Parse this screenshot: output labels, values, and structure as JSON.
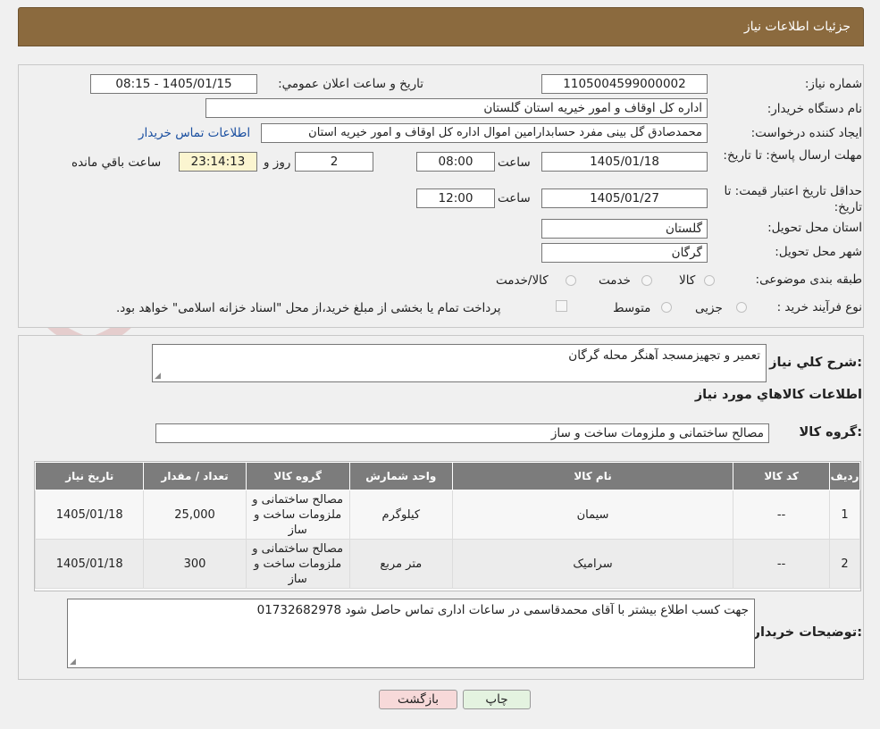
{
  "header": {
    "title": "جزئیات اطلاعات نیاز"
  },
  "form": {
    "need_number_label": "شماره نیاز:",
    "need_number": "1105004599000002",
    "announce_label": "تاریخ و ساعت اعلان عمومي:",
    "announce_value": "1405/01/15 - 08:15",
    "buyer_label": "نام دستگاه خریدار:",
    "buyer_value": "اداره کل اوقاف و امور خیریه استان گلستان",
    "creator_label": "ایجاد کننده درخواست:",
    "creator_value": "محمدصادق گل بینی مفرد حسابدارامین اموال اداره کل اوقاف و امور خیریه استان",
    "contact_link": "اطلاعات تماس خریدار",
    "deadline_label": "مهلت ارسال پاسخ: تا تاریخ:",
    "deadline_date": "1405/01/18",
    "time_label": "ساعت",
    "deadline_time": "08:00",
    "days_value": "2",
    "days_label": "روز و",
    "remaining_value": "23:14:13",
    "remaining_label": "ساعت باقي مانده",
    "validity_label": "حداقل تاریخ اعتبار قیمت: تا تاریخ:",
    "validity_date": "1405/01/27",
    "validity_time": "12:00",
    "province_label": "استان محل تحویل:",
    "province_value": "گلستان",
    "city_label": "شهر محل تحویل:",
    "city_value": "گرگان",
    "category_label": "طبقه بندی موضوعی:",
    "category_options": [
      "کالا",
      "خدمت",
      "کالا/خدمت"
    ],
    "process_label": "نوع فرآیند خرید :",
    "process_options": [
      "جزیی",
      "متوسط"
    ],
    "payment_note": "پرداخت تمام یا بخشی از مبلغ خرید،از محل \"اسناد خزانه اسلامی\" خواهد بود."
  },
  "description": {
    "label": "شرح کلي نیاز:",
    "value": "تعمیر و تجهیزمسجد آهنگر محله گرگان"
  },
  "goods": {
    "section_title": "اطلاعات کالاهاي مورد نیاز",
    "group_label": "گروه کالا:",
    "group_value": "مصالح ساختمانی و ملزومات ساخت و ساز",
    "columns": [
      "ردیف",
      "کد کالا",
      "نام کالا",
      "واحد شمارش",
      "گروه کالا",
      "تعداد / مقدار",
      "تاریخ نیاز"
    ],
    "rows": [
      {
        "row": "1",
        "code": "--",
        "name": "سیمان",
        "unit": "کیلوگرم",
        "group": "مصالح ساختمانی و ملزومات ساخت و ساز",
        "qty": "25,000",
        "date": "1405/01/18"
      },
      {
        "row": "2",
        "code": "--",
        "name": "سرامیک",
        "unit": "متر مربع",
        "group": "مصالح ساختمانی و ملزومات ساخت و ساز",
        "qty": "300",
        "date": "1405/01/18"
      }
    ]
  },
  "buyer_notes": {
    "label": "توضیحات خریدار:",
    "value": "جهت کسب اطلاع بیشتر با آقای محمدقاسمی در ساعات اداری تماس حاصل شود  01732682978"
  },
  "buttons": {
    "print": "چاپ",
    "back": "بازگشت"
  },
  "watermark": {
    "text": "AriaTender.neT"
  },
  "colors": {
    "header": "#8b6a3e",
    "table_header": "#7c7c7c",
    "link": "#1a4fa0",
    "back_button": "#f7d9d9",
    "print_button": "#e4f3e0",
    "remaining": "#fbf5d0"
  }
}
